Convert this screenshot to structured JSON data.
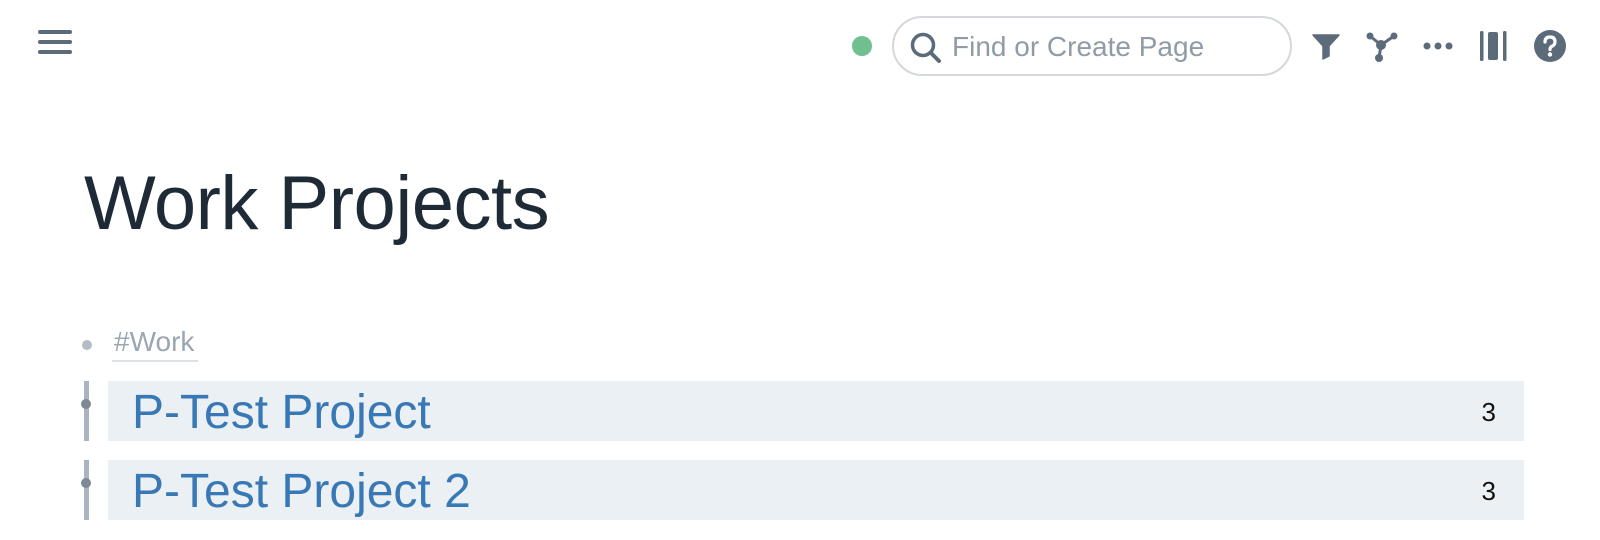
{
  "topbar": {
    "menu_icon": "hamburger-menu-icon",
    "sync_status_color": "#6fbf8f",
    "search": {
      "placeholder": "Find or Create Page",
      "value": ""
    },
    "tools": [
      {
        "name": "filter-icon"
      },
      {
        "name": "graph-icon"
      },
      {
        "name": "more-icon"
      },
      {
        "name": "sidebar-toggle-icon"
      },
      {
        "name": "help-icon"
      }
    ]
  },
  "page": {
    "title": "Work Projects",
    "tag": "#Work",
    "references": [
      {
        "title": "P-Test Project",
        "count": "3"
      },
      {
        "title": "P-Test Project 2",
        "count": "3"
      }
    ]
  },
  "colors": {
    "link": "#3878b5",
    "ref_background": "#ebf0f4",
    "title_text": "#1e2a36"
  }
}
